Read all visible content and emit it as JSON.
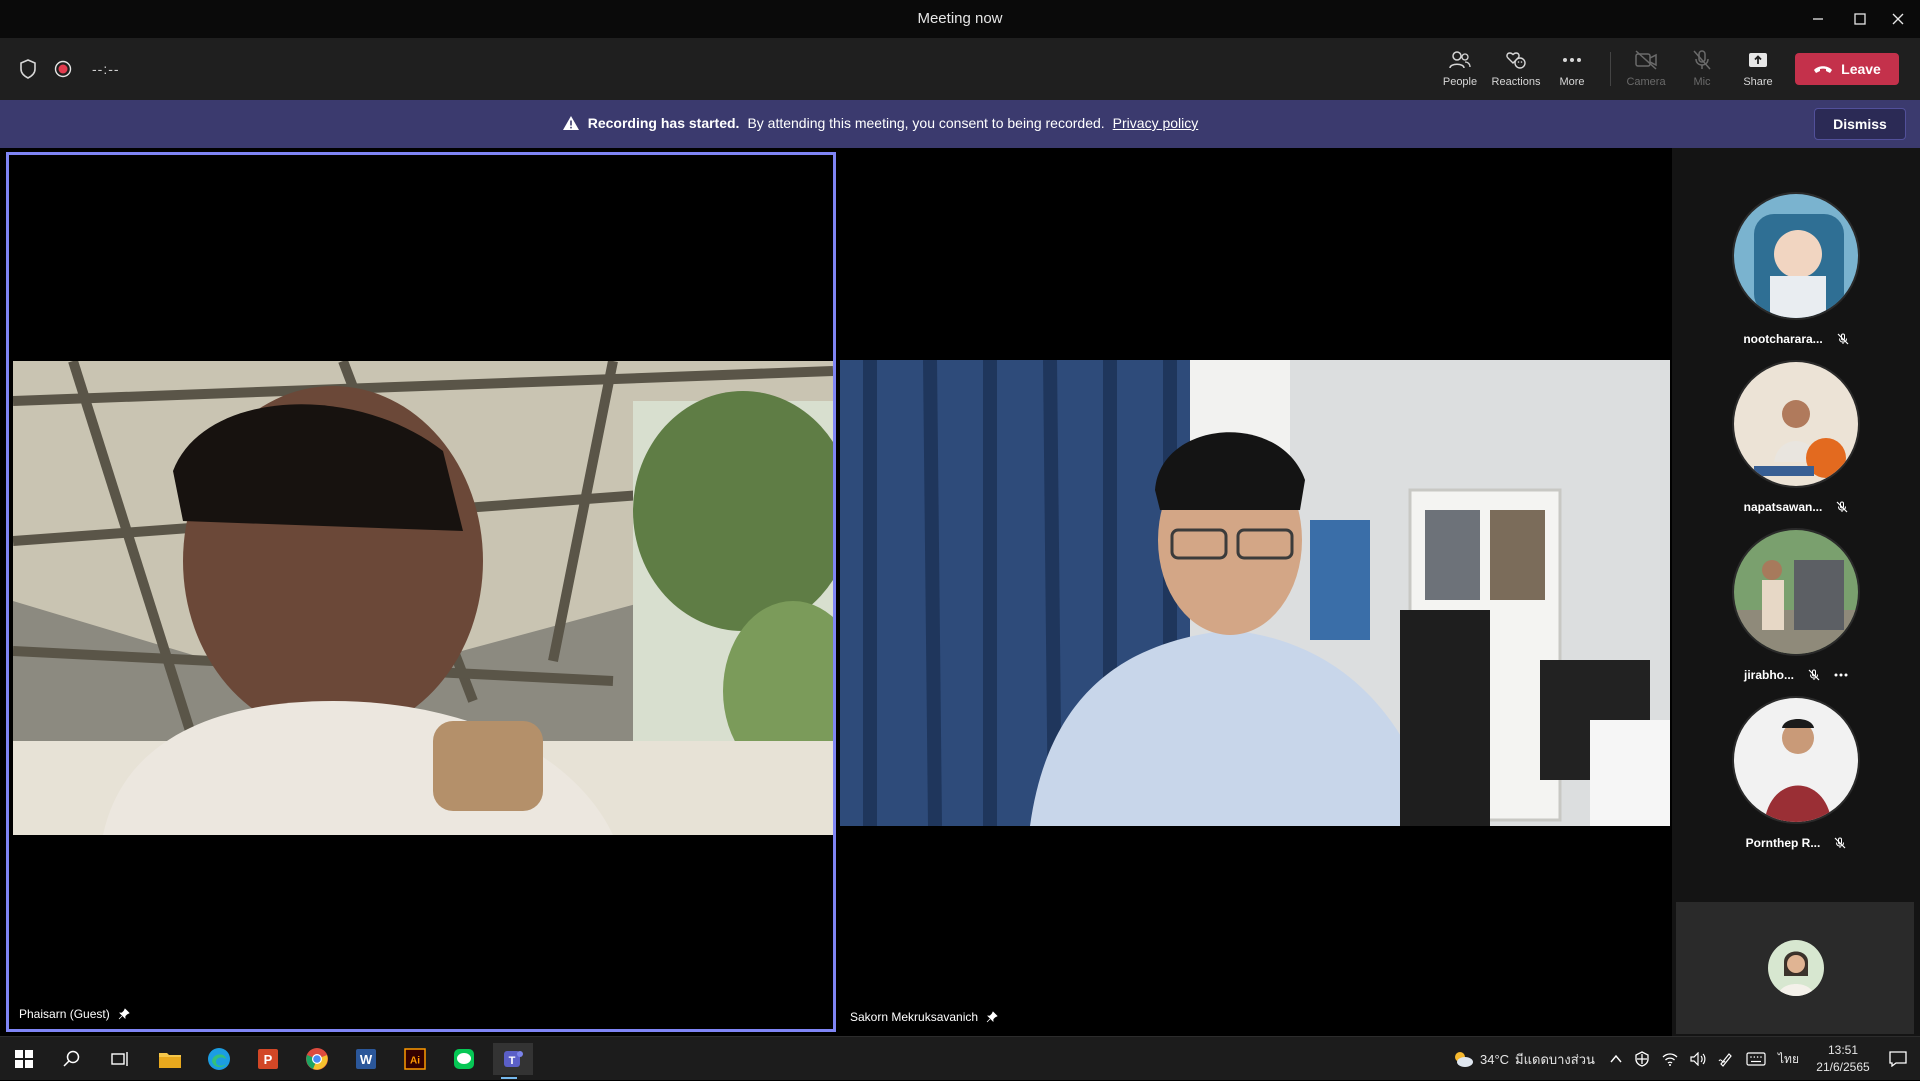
{
  "window": {
    "title": "Meeting now"
  },
  "toolbar": {
    "timer": "--:--",
    "people": "People",
    "reactions": "Reactions",
    "more": "More",
    "camera": "Camera",
    "mic": "Mic",
    "share": "Share",
    "leave": "Leave"
  },
  "banner": {
    "title": "Recording has started.",
    "message": "By attending this meeting, you consent to being recorded.",
    "link": "Privacy policy",
    "dismiss": "Dismiss"
  },
  "stage": {
    "tiles": [
      {
        "name": "Phaisarn (Guest)",
        "active": true
      },
      {
        "name": "Sakorn Mekruksavanich",
        "active": false
      }
    ]
  },
  "participants": [
    {
      "name": "nootcharara...",
      "muted": true
    },
    {
      "name": "napatsawan...",
      "muted": true
    },
    {
      "name": "jirabho...",
      "muted": true,
      "more": true
    },
    {
      "name": "Pornthep R...",
      "muted": true
    }
  ],
  "taskbar": {
    "weather": "34°C",
    "weather_text": "มีแดดบางส่วน",
    "lang": "ไทย",
    "time": "13:51",
    "date": "21/6/2565"
  },
  "colors": {
    "banner_bg": "#3b3a6e",
    "leave_bg": "#c4314b",
    "active_tile_border": "#7f85f5",
    "recording_dot": "#e23b4e"
  }
}
